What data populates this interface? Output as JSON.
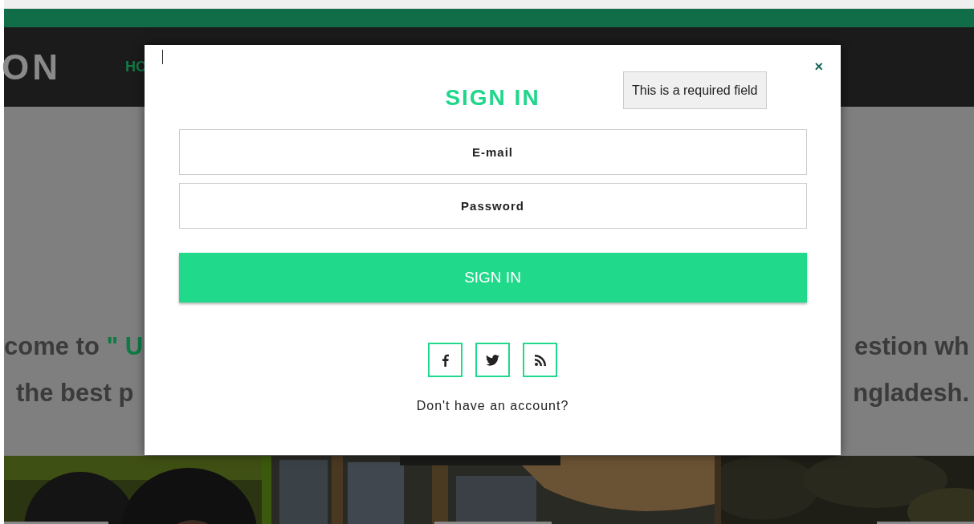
{
  "nav": {
    "logo": "ON",
    "links": [
      {
        "label": "HO"
      }
    ]
  },
  "hero": {
    "lines": [
      {
        "left": [
          {
            "text": "come to ",
            "kind": "plain"
          },
          {
            "text": "\" U",
            "kind": "accent"
          }
        ],
        "right": "estion wh"
      },
      {
        "left": [
          {
            "text": "the best p",
            "kind": "plain"
          }
        ],
        "right": "ngladesh."
      }
    ]
  },
  "modal": {
    "tooltip": "This is a required field",
    "close": "×",
    "title": "SIGN IN",
    "fields": [
      {
        "placeholder": "E-mail"
      },
      {
        "placeholder": "Password"
      }
    ],
    "submit": "SIGN IN",
    "social": [
      {
        "kind": "facebook"
      },
      {
        "kind": "twitter"
      },
      {
        "kind": "rss"
      }
    ],
    "footer": "Don't have an account?"
  }
}
